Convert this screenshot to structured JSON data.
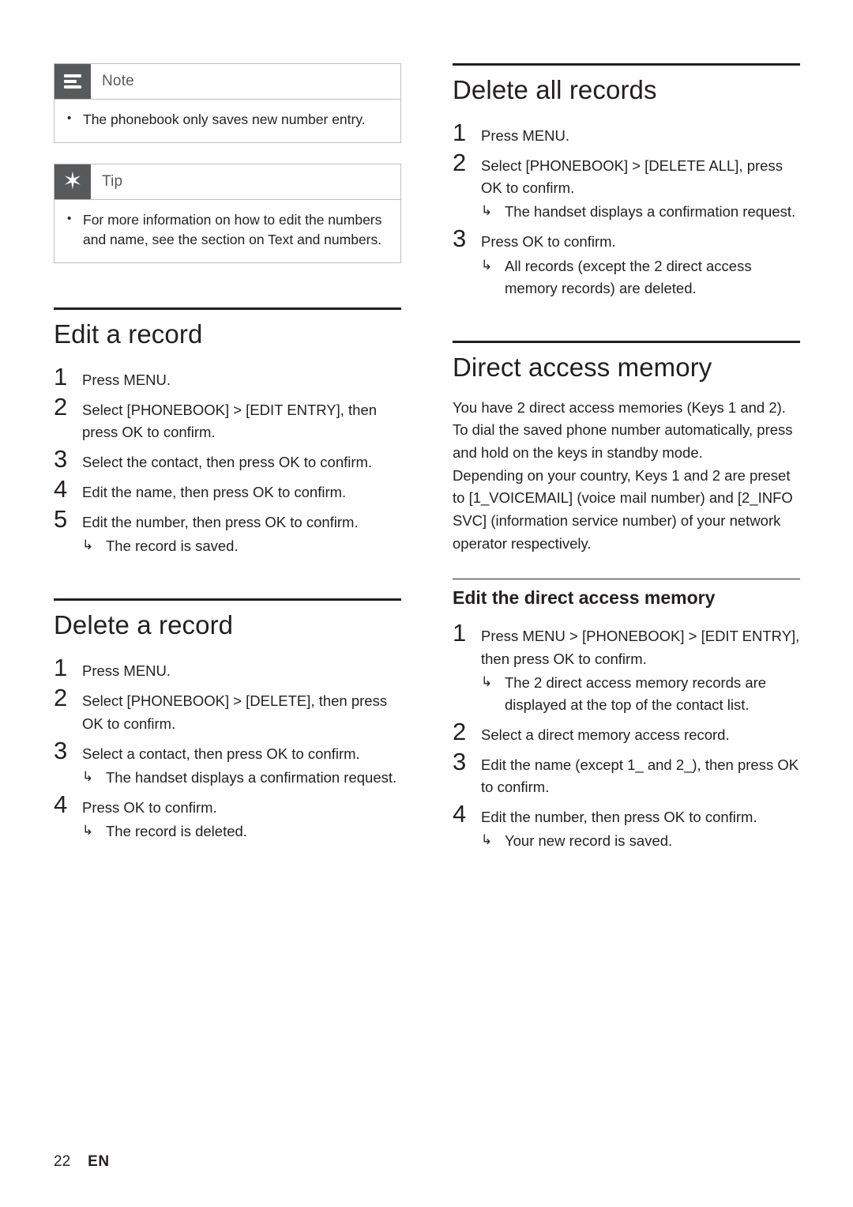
{
  "page": {
    "number": "22",
    "language": "EN"
  },
  "left_column": {
    "note_box": {
      "icon": "note-icon",
      "title": "Note",
      "bullet": "•",
      "text": "The phonebook only saves new number entry."
    },
    "tip_box": {
      "icon": "tip-icon",
      "title": "Tip",
      "bullet": "•",
      "text": "For more information on how to edit the numbers and name, see the section on Text and numbers."
    },
    "section_edit": {
      "title": "Edit a record",
      "steps": [
        {
          "num": "1",
          "text": "Press MENU."
        },
        {
          "num": "2",
          "text": "Select [PHONEBOOK] > [EDIT ENTRY], then press OK to confirm."
        },
        {
          "num": "3",
          "text": "Select the contact, then press OK to confirm."
        },
        {
          "num": "4",
          "text": "Edit the name, then press OK to confirm."
        },
        {
          "num": "5",
          "text": "Edit the number, then press OK to confirm.",
          "result": "The record is saved."
        }
      ]
    },
    "section_delete": {
      "title": "Delete a record",
      "steps": [
        {
          "num": "1",
          "text": "Press MENU."
        },
        {
          "num": "2",
          "text": "Select [PHONEBOOK] > [DELETE], then press OK to confirm."
        },
        {
          "num": "3",
          "text": "Select a contact, then press OK to confirm.",
          "result": "The handset displays a confirmation request."
        },
        {
          "num": "4",
          "text": "Press OK to confirm.",
          "result": "The record is deleted."
        }
      ]
    }
  },
  "right_column": {
    "section_delete_all": {
      "title": "Delete all records",
      "steps": [
        {
          "num": "1",
          "text": "Press MENU."
        },
        {
          "num": "2",
          "text": "Select [PHONEBOOK] > [DELETE ALL], press OK to confirm.",
          "result": "The handset displays a confirmation request."
        },
        {
          "num": "3",
          "text": "Press OK to confirm.",
          "result": "All records (except the 2 direct access memory records) are deleted."
        }
      ]
    },
    "section_direct_access": {
      "title": "Direct access memory",
      "paragraph1": "You have 2 direct access memories (Keys 1 and 2). To dial the saved phone number automatically, press and hold on the keys in standby mode.",
      "paragraph2": "Depending on your country, Keys 1 and 2 are preset to [1_VOICEMAIL] (voice mail number) and [2_INFO SVC] (information service number) of your network operator respectively.",
      "subsection": {
        "title": "Edit the direct access memory",
        "steps": [
          {
            "num": "1",
            "text": "Press MENU > [PHONEBOOK] > [EDIT ENTRY], then press OK to confirm.",
            "result": "The 2 direct access memory records are displayed at the top of the contact list."
          },
          {
            "num": "2",
            "text": "Select a direct memory access record."
          },
          {
            "num": "3",
            "text": "Edit the name (except 1_ and 2_), then press OK to confirm."
          },
          {
            "num": "4",
            "text": "Edit the number, then press OK to confirm.",
            "result": "Your new record is saved."
          }
        ]
      }
    }
  },
  "glyphs": {
    "arrow": "↳"
  }
}
